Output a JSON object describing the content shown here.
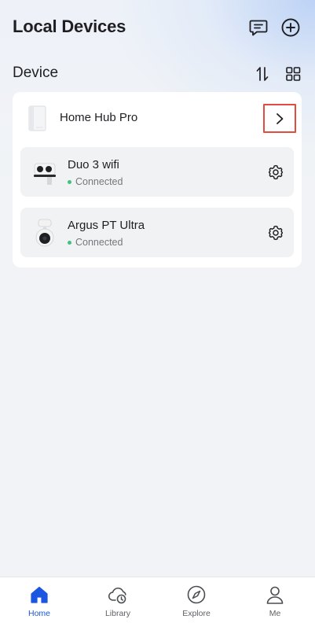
{
  "header": {
    "title": "Local Devices"
  },
  "section": {
    "title": "Device"
  },
  "hub": {
    "name": "Home Hub Pro"
  },
  "cameras": [
    {
      "name": "Duo 3 wifi",
      "status": "Connected"
    },
    {
      "name": "Argus PT Ultra",
      "status": "Connected"
    }
  ],
  "tabs": [
    {
      "label": "Home",
      "icon": "home-icon",
      "active": true
    },
    {
      "label": "Library",
      "icon": "cloud-clock-icon",
      "active": false
    },
    {
      "label": "Explore",
      "icon": "compass-icon",
      "active": false
    },
    {
      "label": "Me",
      "icon": "person-icon",
      "active": false
    }
  ],
  "colors": {
    "accent": "#1a56e0",
    "status_online": "#3cc47c",
    "highlight_box": "#e34b3f"
  }
}
